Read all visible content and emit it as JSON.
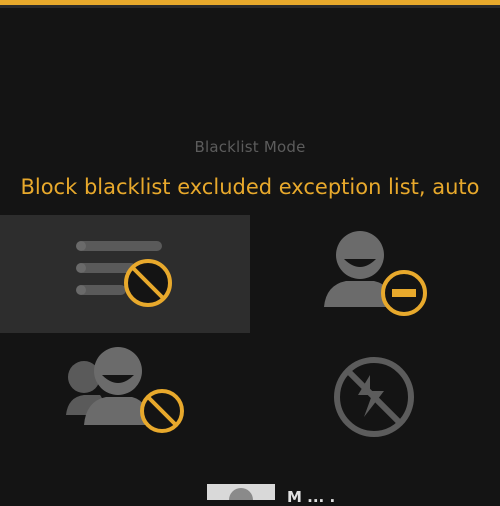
{
  "header": {
    "mode_label": "Blacklist Mode",
    "mode_value": "Block blacklist excluded exception list, auto"
  },
  "accent_color": "#e8a92c",
  "options": [
    {
      "icon": "list-block-icon",
      "selected": true
    },
    {
      "icon": "person-minus-icon",
      "selected": false
    },
    {
      "icon": "group-block-icon",
      "selected": false
    },
    {
      "icon": "no-calls-icon",
      "selected": false
    }
  ],
  "preview": {
    "icon": "contact-thumbnail",
    "text": "M  ...  ."
  }
}
